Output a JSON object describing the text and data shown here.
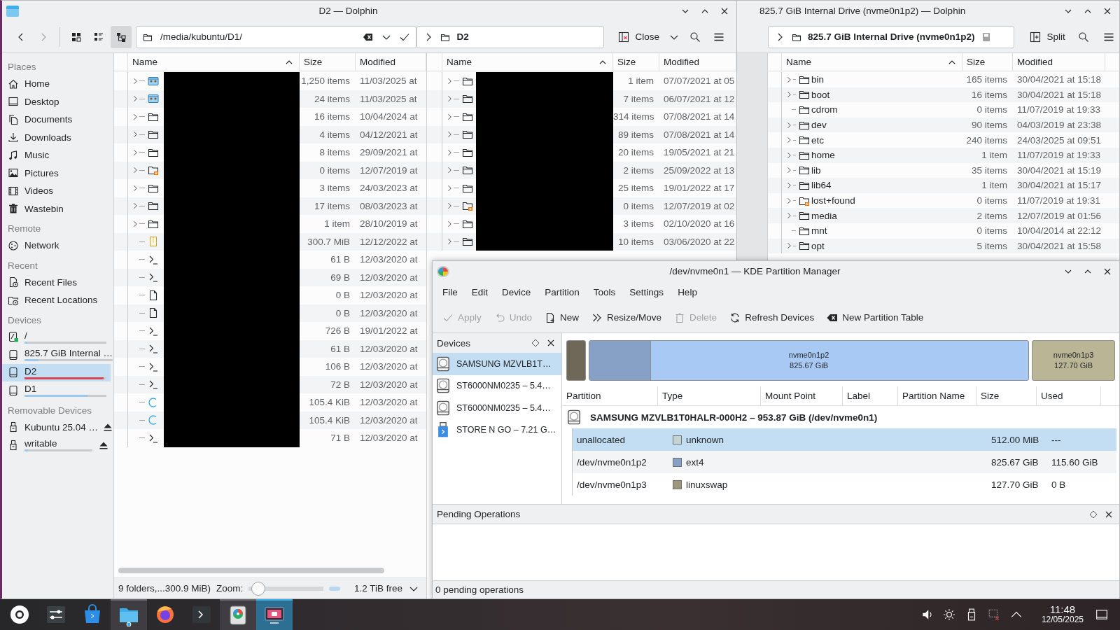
{
  "dolphin_left": {
    "title": "D2 — Dolphin",
    "view_modes": [
      {
        "kind": "icons",
        "selected": false
      },
      {
        "kind": "compact",
        "selected": false
      },
      {
        "kind": "details",
        "selected": true
      }
    ],
    "path": "/media/kubuntu/D1/",
    "places": [
      {
        "heading": "Places",
        "items": [
          {
            "label": "Home",
            "kind": "home",
            "selected": false
          },
          {
            "label": "Desktop",
            "kind": "desktop",
            "selected": false
          },
          {
            "label": "Documents",
            "kind": "documents",
            "selected": false
          },
          {
            "label": "Downloads",
            "kind": "downloads",
            "selected": false
          },
          {
            "label": "Music",
            "kind": "music",
            "selected": false
          },
          {
            "label": "Pictures",
            "kind": "pictures",
            "selected": false
          },
          {
            "label": "Videos",
            "kind": "videos",
            "selected": false
          },
          {
            "label": "Wastebin",
            "kind": "trash",
            "selected": false
          }
        ]
      },
      {
        "heading": "Remote",
        "items": [
          {
            "label": "Network",
            "kind": "network",
            "selected": false
          }
        ]
      },
      {
        "heading": "Recent",
        "items": [
          {
            "label": "Recent Files",
            "kind": "recent-files",
            "selected": false
          },
          {
            "label": "Recent Locations",
            "kind": "recent-locations",
            "selected": false
          }
        ]
      },
      {
        "heading": "Devices",
        "items": [
          {
            "label": "/",
            "kind": "root",
            "selected": false,
            "level": 0.03
          },
          {
            "label": "825.7 GiB Internal …",
            "kind": "drive",
            "selected": false,
            "level": 0.16
          },
          {
            "label": "D2",
            "kind": "drive",
            "selected": true,
            "level": 0.97
          },
          {
            "label": "D1",
            "kind": "drive",
            "selected": false,
            "level": 0.77
          }
        ]
      },
      {
        "heading": "Removable Devices",
        "items": [
          {
            "label": "Kubuntu 25.04 …",
            "kind": "usb",
            "selected": false,
            "ejectable": true
          },
          {
            "label": "writable",
            "kind": "usb",
            "selected": false,
            "ejectable": true,
            "level": 0.05
          }
        ]
      }
    ],
    "pane": {
      "columns": [
        {
          "label": "Name",
          "sorted": true
        },
        {
          "label": "Size",
          "sorted": false
        },
        {
          "label": "Modified",
          "sorted": false
        }
      ],
      "rows": [
        {
          "kind": "image-folder",
          "expandable": true,
          "size": "1,250 items",
          "modified": "11/03/2025 at"
        },
        {
          "kind": "image-folder",
          "expandable": true,
          "size": "24 items",
          "modified": "11/03/2025 at"
        },
        {
          "kind": "folder",
          "expandable": true,
          "size": "16 items",
          "modified": "10/04/2024 at"
        },
        {
          "kind": "folder",
          "expandable": true,
          "size": "4 items",
          "modified": "04/12/2021 at"
        },
        {
          "kind": "folder",
          "expandable": true,
          "size": "8 items",
          "modified": "29/09/2021 at"
        },
        {
          "kind": "locked-folder",
          "expandable": true,
          "size": "0 items",
          "modified": "12/07/2019 at"
        },
        {
          "kind": "folder",
          "expandable": true,
          "size": "3 items",
          "modified": "24/03/2023 at"
        },
        {
          "kind": "folder",
          "expandable": true,
          "size": "17 items",
          "modified": "08/03/2023 at"
        },
        {
          "kind": "folder",
          "expandable": true,
          "size": "1 item",
          "modified": "28/10/2019 at"
        },
        {
          "kind": "archive",
          "expandable": false,
          "size": "300.7 MiB",
          "modified": "12/12/2022 at"
        },
        {
          "kind": "script",
          "expandable": false,
          "size": "61 B",
          "modified": "12/03/2020 at"
        },
        {
          "kind": "script",
          "expandable": false,
          "size": "69 B",
          "modified": "12/03/2020 at"
        },
        {
          "kind": "file",
          "expandable": false,
          "size": "0 B",
          "modified": "12/03/2020 at"
        },
        {
          "kind": "file",
          "expandable": false,
          "size": "0 B",
          "modified": "12/03/2020 at"
        },
        {
          "kind": "script",
          "expandable": false,
          "size": "726 B",
          "modified": "19/01/2022 at"
        },
        {
          "kind": "script",
          "expandable": false,
          "size": "61 B",
          "modified": "12/03/2020 at"
        },
        {
          "kind": "script",
          "expandable": false,
          "size": "106 B",
          "modified": "12/03/2020 at"
        },
        {
          "kind": "script",
          "expandable": false,
          "size": "72 B",
          "modified": "12/03/2020 at"
        },
        {
          "kind": "disc",
          "expandable": false,
          "size": "105.4 KiB",
          "modified": "12/03/2020 at"
        },
        {
          "kind": "disc",
          "expandable": false,
          "size": "105.4 KiB",
          "modified": "12/03/2020 at"
        },
        {
          "kind": "script",
          "expandable": false,
          "size": "71 B",
          "modified": "12/03/2020 at"
        }
      ],
      "status": "9 folders,...300.9 MiB)",
      "zoom": {
        "label": "Zoom:",
        "level": 0.03
      },
      "free_space": "1.2 TiB free"
    },
    "split_pane": {
      "location": "D2",
      "close_label": "Close",
      "columns": [
        {
          "label": "Name",
          "sorted": true
        },
        {
          "label": "Size",
          "sorted": false
        },
        {
          "label": "Modified",
          "sorted": false
        }
      ],
      "rows": [
        {
          "kind": "folder",
          "expandable": true,
          "size": "1 item",
          "modified": "07/07/2021 at 05"
        },
        {
          "kind": "folder",
          "expandable": true,
          "size": "7 items",
          "modified": "06/07/2021 at 12"
        },
        {
          "kind": "folder",
          "expandable": true,
          "size": "314 items",
          "modified": "07/08/2021 at 14"
        },
        {
          "kind": "folder",
          "expandable": true,
          "size": "89 items",
          "modified": "07/08/2021 at 14"
        },
        {
          "kind": "folder",
          "expandable": true,
          "size": "20 items",
          "modified": "19/05/2021 at 21"
        },
        {
          "kind": "folder",
          "expandable": true,
          "size": "2 items",
          "modified": "25/09/2022 at 13"
        },
        {
          "kind": "folder",
          "expandable": true,
          "size": "25 items",
          "modified": "19/01/2022 at 17"
        },
        {
          "kind": "locked-folder",
          "expandable": true,
          "size": "0 items",
          "modified": "12/07/2019 at 02"
        },
        {
          "kind": "folder",
          "expandable": true,
          "size": "3 items",
          "modified": "02/10/2020 at 16"
        },
        {
          "kind": "folder",
          "expandable": true,
          "size": "10 items",
          "modified": "03/06/2020 at 22"
        }
      ]
    }
  },
  "dolphin_right": {
    "title": "825.7 GiB Internal Drive (nvme0n1p2) — Dolphin",
    "location": "825.7 GiB Internal Drive (nvme0n1p2)",
    "split_label": "Split",
    "columns": [
      {
        "label": "Name",
        "sorted": true
      },
      {
        "label": "Size",
        "sorted": false
      },
      {
        "label": "Modified",
        "sorted": false
      }
    ],
    "rows": [
      {
        "name": "bin",
        "kind": "folder",
        "expandable": true,
        "size": "165 items",
        "modified": "30/04/2021 at 15:18"
      },
      {
        "name": "boot",
        "kind": "folder",
        "expandable": true,
        "size": "16 items",
        "modified": "30/04/2021 at 15:18"
      },
      {
        "name": "cdrom",
        "kind": "folder",
        "expandable": false,
        "size": "0 items",
        "modified": "11/07/2019 at 19:33"
      },
      {
        "name": "dev",
        "kind": "folder",
        "expandable": true,
        "size": "90 items",
        "modified": "04/03/2019 at 23:38"
      },
      {
        "name": "etc",
        "kind": "folder",
        "expandable": true,
        "size": "240 items",
        "modified": "24/03/2025 at 09:51"
      },
      {
        "name": "home",
        "kind": "folder",
        "expandable": true,
        "size": "1 item",
        "modified": "11/07/2019 at 19:33"
      },
      {
        "name": "lib",
        "kind": "folder",
        "expandable": true,
        "size": "35 items",
        "modified": "30/04/2021 at 15:19"
      },
      {
        "name": "lib64",
        "kind": "folder",
        "expandable": true,
        "size": "1 item",
        "modified": "30/04/2021 at 15:17"
      },
      {
        "name": "lost+found",
        "kind": "locked-folder",
        "expandable": true,
        "size": "0 items",
        "modified": "11/07/2019 at 19:31"
      },
      {
        "name": "media",
        "kind": "folder",
        "expandable": true,
        "size": "2 items",
        "modified": "12/07/2019 at 01:56"
      },
      {
        "name": "mnt",
        "kind": "folder",
        "expandable": false,
        "size": "0 items",
        "modified": "10/04/2014 at 22:12"
      },
      {
        "name": "opt",
        "kind": "folder",
        "expandable": true,
        "size": "5 items",
        "modified": "30/04/2021 at 15:58"
      }
    ]
  },
  "partition_manager": {
    "title": "/dev/nvme0n1 — KDE Partition Manager",
    "menu": [
      "File",
      "Edit",
      "Device",
      "Partition",
      "Tools",
      "Settings",
      "Help"
    ],
    "toolbar": [
      {
        "label": "Apply",
        "kind": "apply",
        "disabled": true
      },
      {
        "label": "Undo",
        "kind": "undo",
        "disabled": true
      },
      {
        "label": "New",
        "kind": "new",
        "disabled": false
      },
      {
        "label": "Resize/Move",
        "kind": "resize",
        "disabled": false
      },
      {
        "label": "Delete",
        "kind": "delete",
        "disabled": true
      },
      {
        "label": "Refresh Devices",
        "kind": "refresh",
        "disabled": false
      },
      {
        "label": "New Partition Table",
        "kind": "table",
        "disabled": false
      }
    ],
    "devices_title": "Devices",
    "devices": [
      {
        "label": "SAMSUNG MZVLB1T…",
        "kind": "disk",
        "selected": true
      },
      {
        "label": "ST6000NM0235 – 5.4…",
        "kind": "disk",
        "selected": false
      },
      {
        "label": "ST6000NM0235 – 5.4…",
        "kind": "disk",
        "selected": false
      },
      {
        "label": "STORE N GO – 7.21 G…",
        "kind": "usb",
        "selected": false
      }
    ],
    "partition_bar": [
      {
        "kind": "unallocated",
        "color": "#6f6858"
      },
      {
        "kind": "partition",
        "label": "nvme0n1p2",
        "size": "825.67 GiB",
        "color": "#a9c9f5",
        "used": {
          "color": "#87a0c6",
          "level": 0.14
        }
      },
      {
        "kind": "partition",
        "label": "nvme0n1p3",
        "size": "127.70 GiB",
        "color": "#bab594"
      }
    ],
    "columns": [
      "Partition",
      "Type",
      "Mount Point",
      "Label",
      "Partition Name",
      "Size",
      "Used"
    ],
    "device_row": "SAMSUNG MZVLB1T0HALR-000H2 – 953.87 GiB (/dev/nvme0n1)",
    "partitions": [
      {
        "partition": "unallocated",
        "type": "unknown",
        "color": "#c4d4d1",
        "size": "512.00 MiB",
        "used": "---",
        "selected": true
      },
      {
        "partition": "/dev/nvme0n1p2",
        "type": "ext4",
        "color": "#87a0c6",
        "size": "825.67 GiB",
        "used": "115.60 GiB",
        "selected": false
      },
      {
        "partition": "/dev/nvme0n1p3",
        "type": "linuxswap",
        "color": "#9b9778",
        "size": "127.70 GiB",
        "used": "0 B",
        "selected": false
      }
    ],
    "pending_title": "Pending Operations",
    "status": "0 pending operations"
  },
  "taskbar": {
    "tasks": [
      {
        "kind": "launcher",
        "open": false,
        "active": false
      },
      {
        "kind": "settings",
        "open": false,
        "active": false
      },
      {
        "kind": "store",
        "open": false,
        "active": false
      },
      {
        "kind": "files",
        "open": true,
        "active": false
      },
      {
        "kind": "browser",
        "open": false,
        "active": false
      },
      {
        "kind": "terminal",
        "open": false,
        "active": false
      },
      {
        "kind": "partitions",
        "open": true,
        "active": false
      },
      {
        "kind": "screenshot",
        "open": true,
        "active": true
      }
    ],
    "time": "11:48",
    "date": "12/05/2025"
  }
}
